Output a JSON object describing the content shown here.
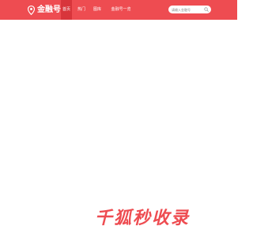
{
  "header": {
    "logo_text": "金融号",
    "nav": [
      {
        "label": "首页",
        "active": true
      },
      {
        "label": "热门",
        "active": false
      },
      {
        "label": "图库",
        "active": false
      },
      {
        "label": "金融号一览",
        "active": false
      }
    ],
    "search": {
      "placeholder": "请输入金融号"
    }
  },
  "watermark": {
    "text": "千狐秒收录"
  },
  "colors": {
    "brand": "#ee4c51",
    "nav_active": "#d8353b",
    "page_bg": "#ffffff"
  },
  "icons": {
    "logo": "map-pin-icon",
    "search": "search-icon"
  }
}
